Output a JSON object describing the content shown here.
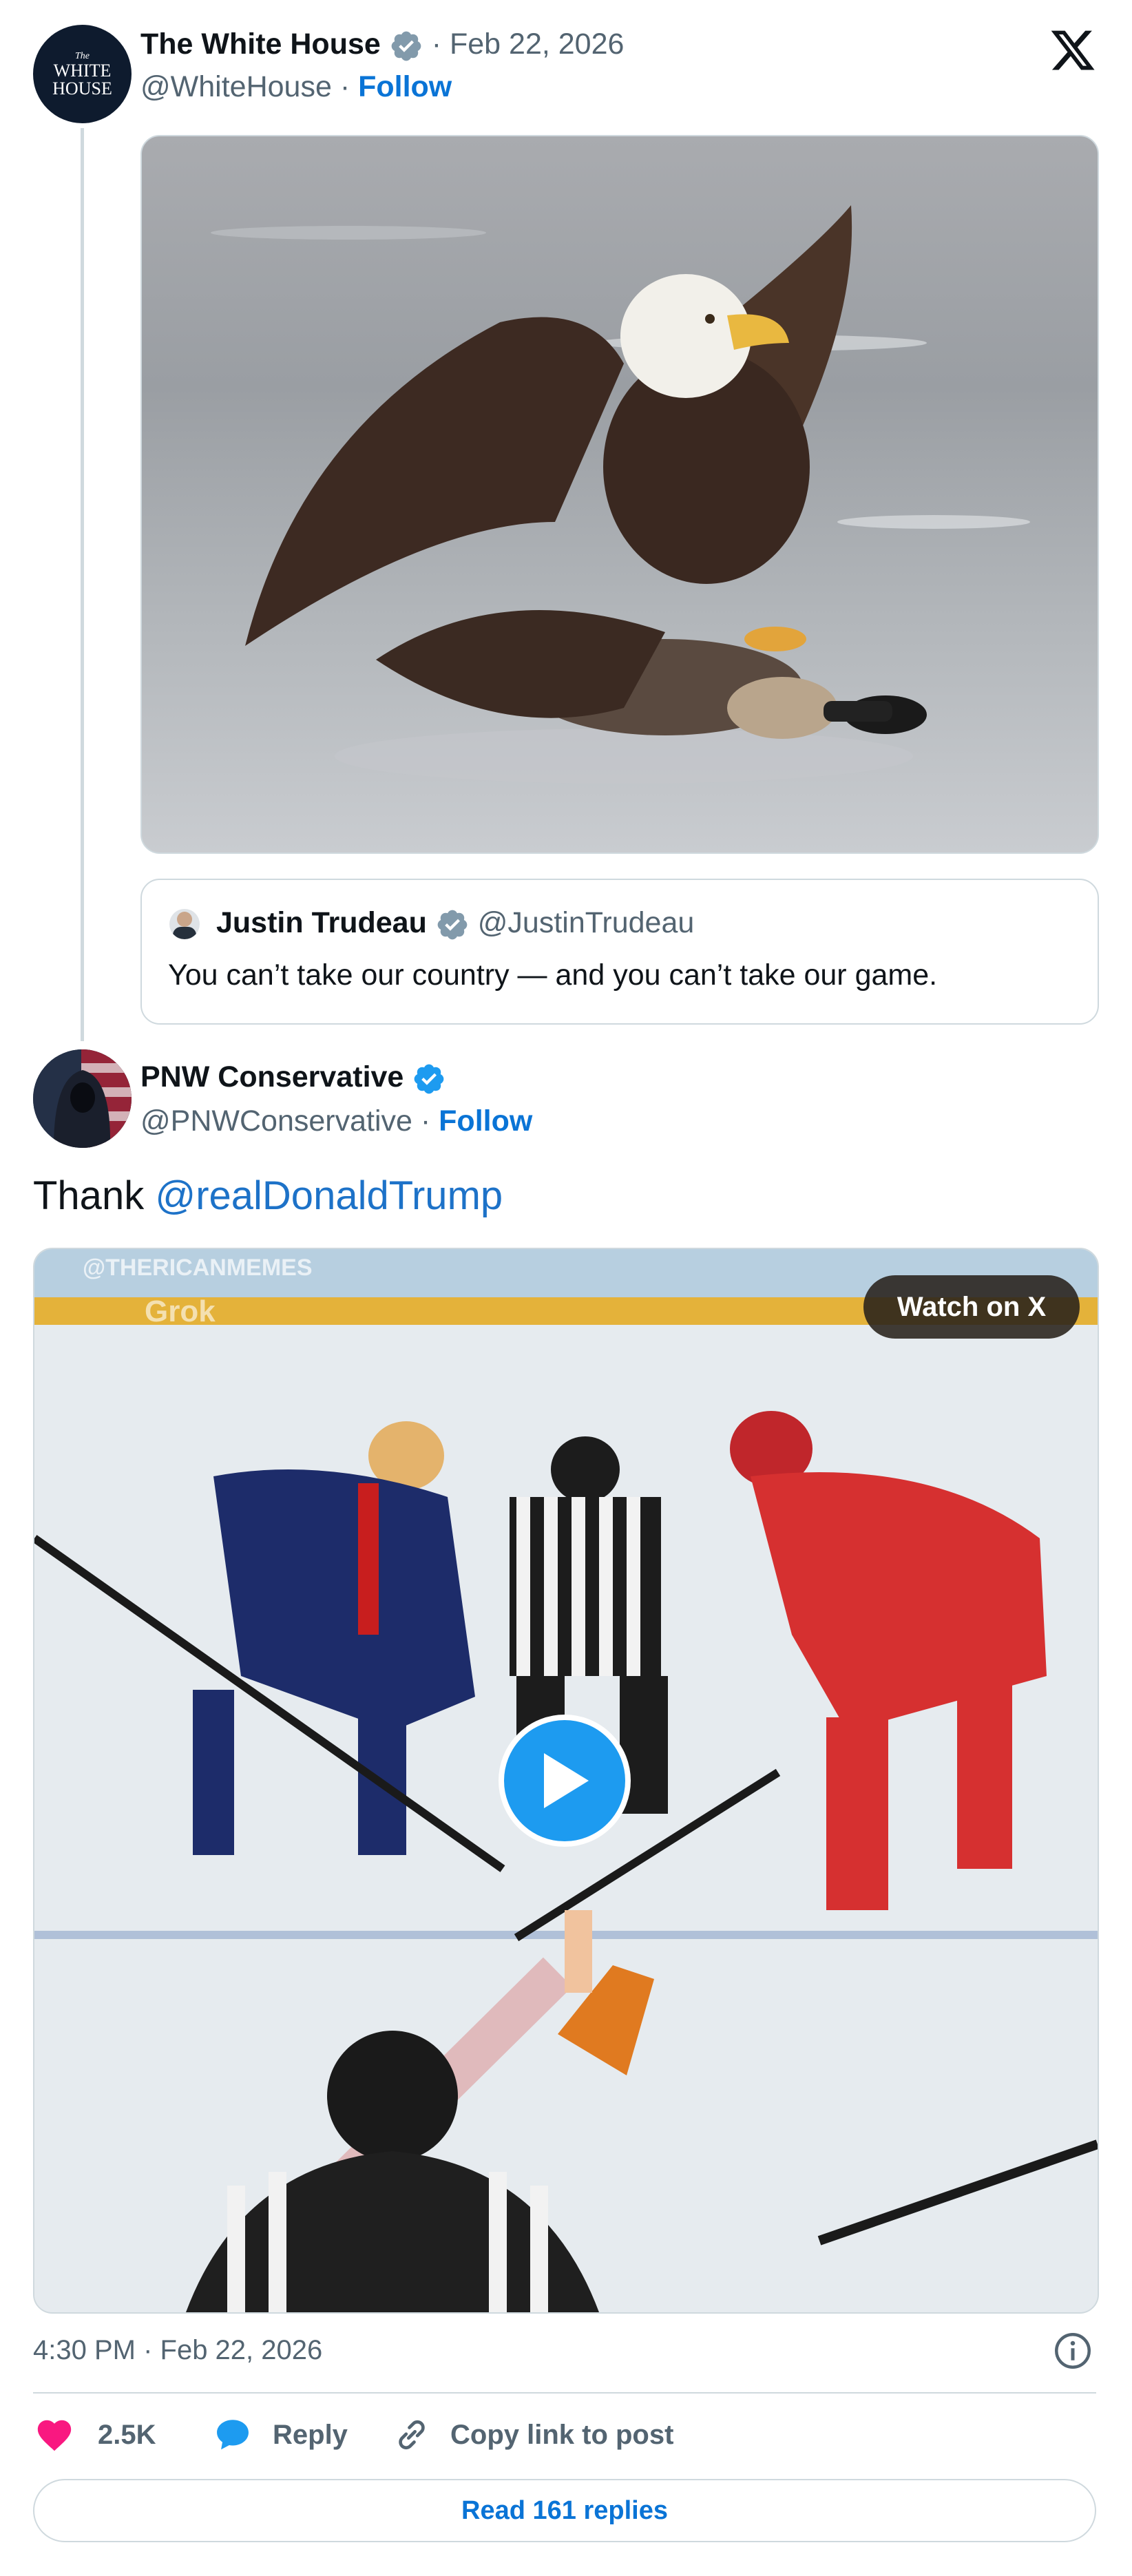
{
  "colors": {
    "accent": "#1d9bf0",
    "link": "#1d72c8",
    "heart": "#f91880",
    "text": "#0f1419",
    "muted": "#536471"
  },
  "embed": {
    "logo_icon": "x-logo-icon"
  },
  "main_tweet": {
    "author_name": "The White House",
    "date_prefix": "·",
    "date": "Feb 22, 2026",
    "handle": "@WhiteHouse",
    "dot": "·",
    "follow_label": "Follow",
    "avatar_text": {
      "small": "The",
      "line1": "WHITE",
      "line2": "HOUSE"
    },
    "image_description_icon": "eagle-photo",
    "quote": {
      "author_name": "Justin Trudeau",
      "handle": "@JustinTrudeau",
      "text": "You can’t take our country — and you can’t take our game."
    }
  },
  "reply_tweet": {
    "author_name": "PNW Conservative",
    "handle": "@PNWConservative",
    "dot": "·",
    "follow_label": "Follow",
    "text_prefix": "Thank",
    "mention": "@realDonaldTrump",
    "video": {
      "watch_label": "Watch on X",
      "watermark_1": "@THERICANMEMES",
      "watermark_2": "Grok",
      "play_icon": "play-icon"
    },
    "timestamp": "4:30 PM · Feb 22, 2026",
    "info_icon": "info-icon"
  },
  "actions": {
    "like_count": "2.5K",
    "reply_label": "Reply",
    "copy_label": "Copy link to post",
    "read_replies_label": "Read 161 replies"
  }
}
